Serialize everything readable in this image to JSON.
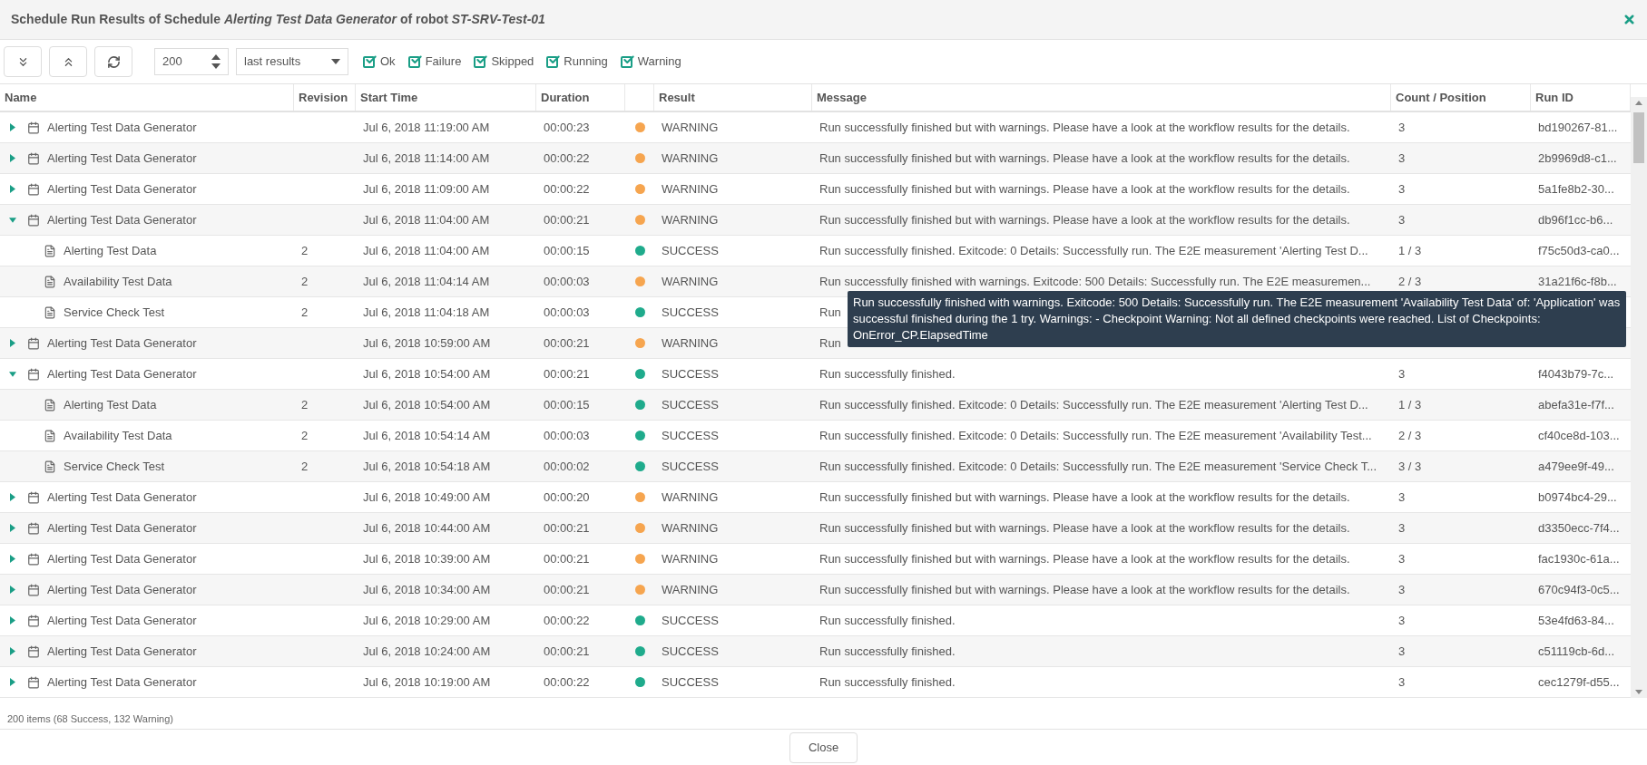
{
  "dialog": {
    "title": "Schedule Run Results of Schedule *Alerting Test Data Generator* of robot *ST-SRV-Test-01*"
  },
  "toolbar": {
    "count_field": {
      "value": "200"
    },
    "range_select": {
      "value": "last results"
    },
    "filters": [
      {
        "label": "Ok",
        "checked": true
      },
      {
        "label": "Failure",
        "checked": true
      },
      {
        "label": "Skipped",
        "checked": true
      },
      {
        "label": "Running",
        "checked": true
      },
      {
        "label": "Warning",
        "checked": true
      }
    ]
  },
  "table": {
    "columns": [
      "Name",
      "Revision",
      "Start Time",
      "Duration",
      "",
      "Result",
      "Message",
      "Count / Position",
      "Run ID"
    ],
    "rows": [
      {
        "name": "Alerting Test Data Generator",
        "expanded": false,
        "start": "Jul 6, 2018 11:19:00 AM",
        "duration": "00:00:23",
        "color": "#f6a54f",
        "result": "WARNING",
        "message": "Run successfully finished but with warnings. Please have a look at the workflow results for the details.",
        "count": "3",
        "run_id": "bd190267-81..."
      },
      {
        "name": "Alerting Test Data Generator",
        "expanded": false,
        "start": "Jul 6, 2018 11:14:00 AM",
        "duration": "00:00:22",
        "color": "#f6a54f",
        "result": "WARNING",
        "message": "Run successfully finished but with warnings. Please have a look at the workflow results for the details.",
        "count": "3",
        "run_id": "2b9969d8-c1..."
      },
      {
        "name": "Alerting Test Data Generator",
        "expanded": false,
        "start": "Jul 6, 2018 11:09:00 AM",
        "duration": "00:00:22",
        "color": "#f6a54f",
        "result": "WARNING",
        "message": "Run successfully finished but with warnings. Please have a look at the workflow results for the details.",
        "count": "3",
        "run_id": "5a1fe8b2-30..."
      },
      {
        "name": "Alerting Test Data Generator",
        "expanded": true,
        "start": "Jul 6, 2018 11:04:00 AM",
        "duration": "00:00:21",
        "color": "#f6a54f",
        "result": "WARNING",
        "message": "Run successfully finished but with warnings. Please have a look at the workflow results for the details.",
        "count": "3",
        "run_id": "db96f1cc-b6...",
        "children": [
          {
            "name": "Alerting Test Data",
            "revision": "2",
            "start": "Jul 6, 2018 11:04:00 AM",
            "duration": "00:00:15",
            "color": "#1fab8c",
            "result": "SUCCESS",
            "message": "Run successfully finished. Exitcode: 0 Details: Successfully run. The E2E measurement 'Alerting Test D...",
            "count": "1 / 3",
            "run_id": "f75c50d3-ca0..."
          },
          {
            "name": "Availability Test Data",
            "revision": "2",
            "start": "Jul 6, 2018 11:04:14 AM",
            "duration": "00:00:03",
            "color": "#f6a54f",
            "result": "WARNING",
            "message": "Run successfully finished with warnings. Exitcode: 500 Details: Successfully run. The E2E measuremen...",
            "count": "2 / 3",
            "run_id": "31a21f6c-f8b..."
          },
          {
            "name": "Service Check Test",
            "revision": "2",
            "start": "Jul 6, 2018 11:04:18 AM",
            "duration": "00:00:03",
            "color": "#1fab8c",
            "result": "SUCCESS",
            "message": "Run"
          }
        ]
      },
      {
        "name": "Alerting Test Data Generator",
        "expanded": false,
        "start": "Jul 6, 2018 10:59:00 AM",
        "duration": "00:00:21",
        "color": "#f6a54f",
        "result": "WARNING",
        "message": "Run"
      },
      {
        "name": "Alerting Test Data Generator",
        "expanded": true,
        "start": "Jul 6, 2018 10:54:00 AM",
        "duration": "00:00:21",
        "color": "#1fab8c",
        "result": "SUCCESS",
        "message": "Run successfully finished.",
        "count": "3",
        "run_id": "f4043b79-7c...",
        "children": [
          {
            "name": "Alerting Test Data",
            "revision": "2",
            "start": "Jul 6, 2018 10:54:00 AM",
            "duration": "00:00:15",
            "color": "#1fab8c",
            "result": "SUCCESS",
            "message": "Run successfully finished. Exitcode: 0 Details: Successfully run. The E2E measurement 'Alerting Test D...",
            "count": "1 / 3",
            "run_id": "abefa31e-f7f..."
          },
          {
            "name": "Availability Test Data",
            "revision": "2",
            "start": "Jul 6, 2018 10:54:14 AM",
            "duration": "00:00:03",
            "color": "#1fab8c",
            "result": "SUCCESS",
            "message": "Run successfully finished. Exitcode: 0 Details: Successfully run. The E2E measurement 'Availability Test...",
            "count": "2 / 3",
            "run_id": "cf40ce8d-103..."
          },
          {
            "name": "Service Check Test",
            "revision": "2",
            "start": "Jul 6, 2018 10:54:18 AM",
            "duration": "00:00:02",
            "color": "#1fab8c",
            "result": "SUCCESS",
            "message": "Run successfully finished. Exitcode: 0 Details: Successfully run. The E2E measurement 'Service Check T...",
            "count": "3 / 3",
            "run_id": "a479ee9f-49..."
          }
        ]
      },
      {
        "name": "Alerting Test Data Generator",
        "expanded": false,
        "start": "Jul 6, 2018 10:49:00 AM",
        "duration": "00:00:20",
        "color": "#f6a54f",
        "result": "WARNING",
        "message": "Run successfully finished but with warnings. Please have a look at the workflow results for the details.",
        "count": "3",
        "run_id": "b0974bc4-29..."
      },
      {
        "name": "Alerting Test Data Generator",
        "expanded": false,
        "start": "Jul 6, 2018 10:44:00 AM",
        "duration": "00:00:21",
        "color": "#f6a54f",
        "result": "WARNING",
        "message": "Run successfully finished but with warnings. Please have a look at the workflow results for the details.",
        "count": "3",
        "run_id": "d3350ecc-7f4..."
      },
      {
        "name": "Alerting Test Data Generator",
        "expanded": false,
        "start": "Jul 6, 2018 10:39:00 AM",
        "duration": "00:00:21",
        "color": "#f6a54f",
        "result": "WARNING",
        "message": "Run successfully finished but with warnings. Please have a look at the workflow results for the details.",
        "count": "3",
        "run_id": "fac1930c-61a..."
      },
      {
        "name": "Alerting Test Data Generator",
        "expanded": false,
        "start": "Jul 6, 2018 10:34:00 AM",
        "duration": "00:00:21",
        "color": "#f6a54f",
        "result": "WARNING",
        "message": "Run successfully finished but with warnings. Please have a look at the workflow results for the details.",
        "count": "3",
        "run_id": "670c94f3-0c5..."
      },
      {
        "name": "Alerting Test Data Generator",
        "expanded": false,
        "start": "Jul 6, 2018 10:29:00 AM",
        "duration": "00:00:22",
        "color": "#1fab8c",
        "result": "SUCCESS",
        "message": "Run successfully finished.",
        "count": "3",
        "run_id": "53e4fd63-84..."
      },
      {
        "name": "Alerting Test Data Generator",
        "expanded": false,
        "start": "Jul 6, 2018 10:24:00 AM",
        "duration": "00:00:21",
        "color": "#1fab8c",
        "result": "SUCCESS",
        "message": "Run successfully finished.",
        "count": "3",
        "run_id": "c51119cb-6d..."
      },
      {
        "name": "Alerting Test Data Generator",
        "expanded": false,
        "start": "Jul 6, 2018 10:19:00 AM",
        "duration": "00:00:22",
        "color": "#1fab8c",
        "result": "SUCCESS",
        "message": "Run successfully finished.",
        "count": "3",
        "run_id": "cec1279f-d55..."
      }
    ]
  },
  "tooltip": {
    "text": "Run successfully finished with warnings. Exitcode: 500 Details: Successfully run. The E2E measurement 'Availability Test Data' of: 'Application' was successful finished during the 1 try. Warnings: - Checkpoint Warning: Not all defined checkpoints were reached. List of Checkpoints: OnError_CP.ElapsedTime"
  },
  "status": {
    "text": "200 items (68 Success, 132 Warning)"
  },
  "buttons": [
    {
      "label": "Close"
    }
  ]
}
